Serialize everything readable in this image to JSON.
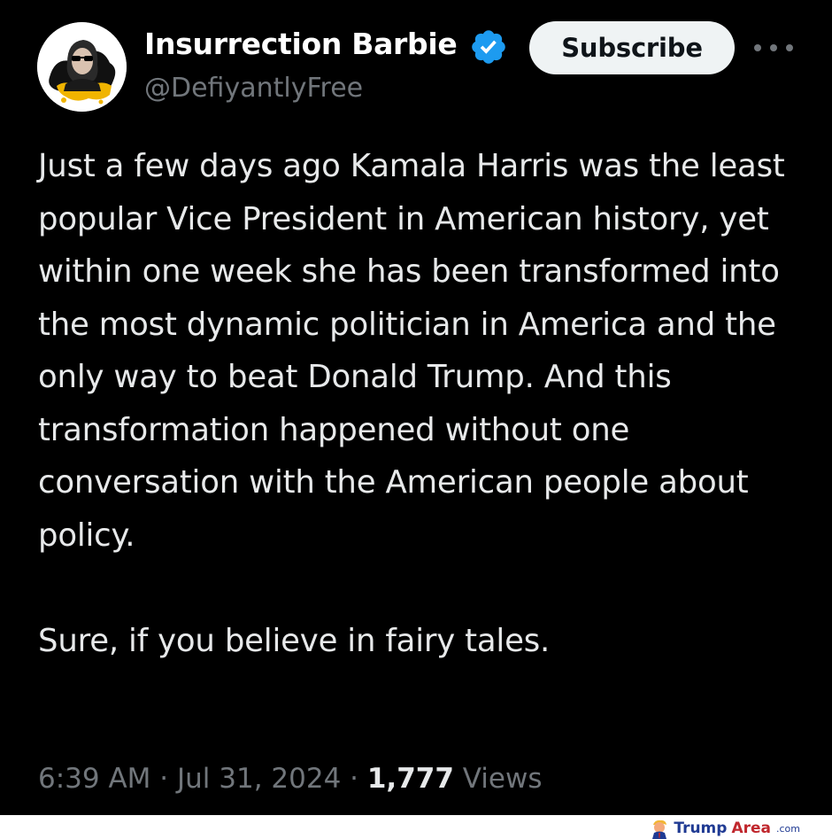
{
  "profile": {
    "display_name": "Insurrection Barbie",
    "handle": "@DefiyantlyFree",
    "avatar_icon": "profile-avatar-photo",
    "verified_icon": "verified-badge-icon"
  },
  "actions": {
    "subscribe_label": "Subscribe",
    "more_icon": "more-options-icon"
  },
  "tweet": {
    "paragraphs": [
      "Just a few days ago Kamala Harris was the least popular Vice President in American history, yet within one week she has been transformed into the most dynamic politician in America and the only way to beat Donald Trump. And this transformation happened without one conversation with the American people about policy.",
      "Sure, if you believe in fairy tales."
    ]
  },
  "meta": {
    "time": "6:39 AM",
    "separator": " · ",
    "date": "Jul 31, 2024",
    "views_count": "1,777",
    "views_label": "Views"
  },
  "watermark": {
    "word_trump": "Trump",
    "word_area": "Area",
    "word_com": ".com"
  },
  "colors": {
    "background": "#000000",
    "text_primary": "#e7e9ea",
    "text_secondary": "#71767b",
    "verified_blue": "#1d9bf0",
    "button_bg": "#eff3f4"
  }
}
